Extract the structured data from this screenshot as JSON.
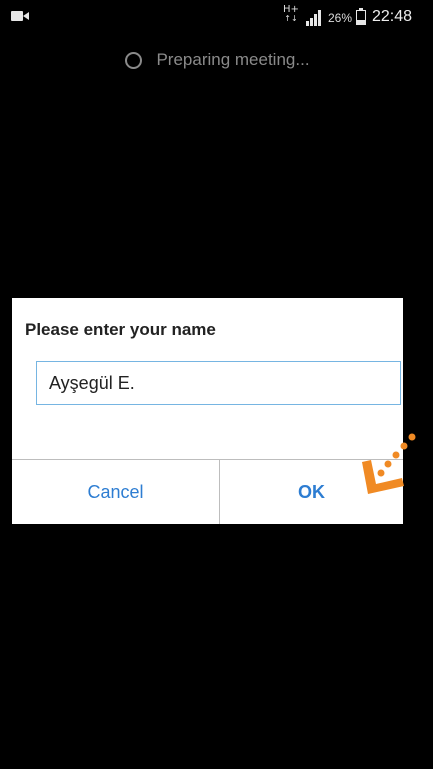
{
  "status_bar": {
    "network_type": "H+",
    "battery_percent": "26%",
    "time": "22:48",
    "icons": [
      "video-camera-icon",
      "signal-icon",
      "battery-icon"
    ]
  },
  "meeting": {
    "status_text": "Preparing meeting..."
  },
  "dialog": {
    "title": "Please enter your name",
    "name_value": "Ayşegül E.",
    "cancel_label": "Cancel",
    "ok_label": "OK"
  },
  "colors": {
    "accent": "#2d7dd2",
    "field_border": "#76b5e2",
    "tap_hint": "#f08a24"
  }
}
